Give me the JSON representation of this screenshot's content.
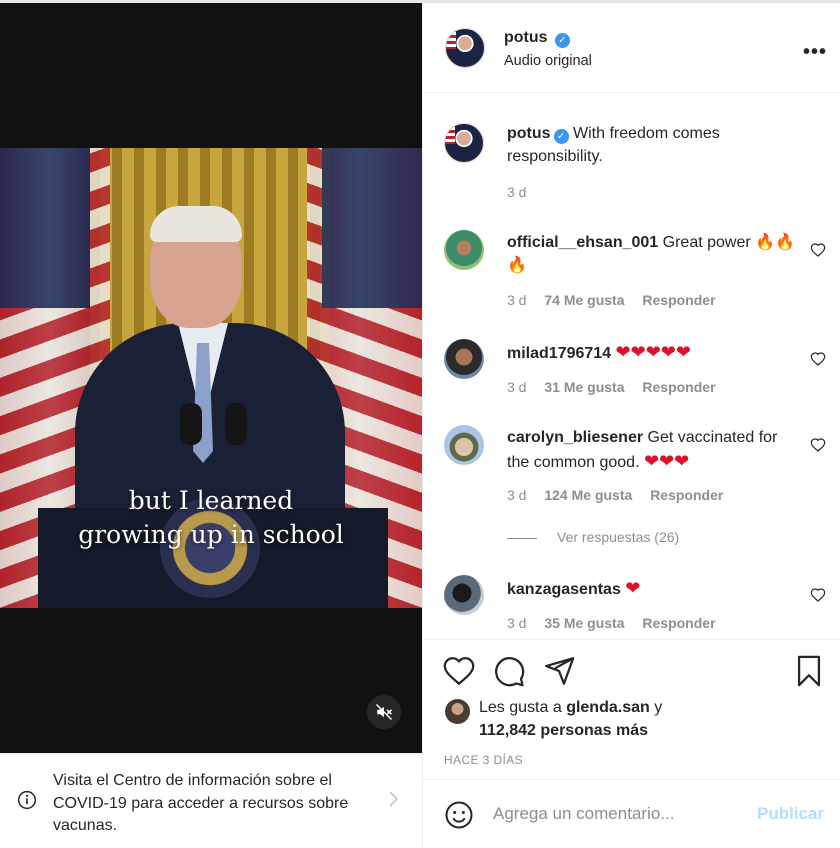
{
  "video": {
    "caption_line1": "but I learned",
    "caption_line2": "growing up in school",
    "mute_icon": "muted-speaker-icon"
  },
  "covid_banner": {
    "text": "Visita el Centro de información sobre el COVID-19 para acceder a recursos sobre vacunas.",
    "icon": "info-icon"
  },
  "post_header": {
    "username": "potus",
    "subtitle": "Audio original",
    "more_icon": "more-options-icon"
  },
  "caption_comment": {
    "username": "potus",
    "text": "With freedom comes responsibility.",
    "time": "3 d"
  },
  "comments": [
    {
      "username": "official__ehsan_001",
      "text": "Great power",
      "emojis": "🔥🔥🔥",
      "time": "3 d",
      "likes": "74 Me gusta",
      "reply": "Responder"
    },
    {
      "username": "milad1796714",
      "text": "",
      "emojis": "❤❤❤❤❤",
      "time": "3 d",
      "likes": "31 Me gusta",
      "reply": "Responder"
    },
    {
      "username": "carolyn_bliesener",
      "text": "Get vaccinated for the common good.",
      "emojis": "❤❤❤",
      "time": "3 d",
      "likes": "124 Me gusta",
      "reply": "Responder",
      "view_replies": "Ver respuestas (26)"
    },
    {
      "username": "kanzagasentas",
      "text": "",
      "emojis": "❤",
      "time": "3 d",
      "likes": "35 Me gusta",
      "reply": "Responder"
    }
  ],
  "actions": {
    "liked_by_prefix": "Les gusta a",
    "liked_by_user": "glenda.san",
    "liked_by_and": "y",
    "others_count": "112,842 personas más",
    "timestamp": "HACE 3 DÍAS"
  },
  "add_comment": {
    "placeholder": "Agrega un comentario...",
    "post_label": "Publicar"
  },
  "colors": {
    "verified": "#3897f0",
    "publish_disabled": "#b2dffc",
    "heart_emoji": "#e0102b"
  }
}
